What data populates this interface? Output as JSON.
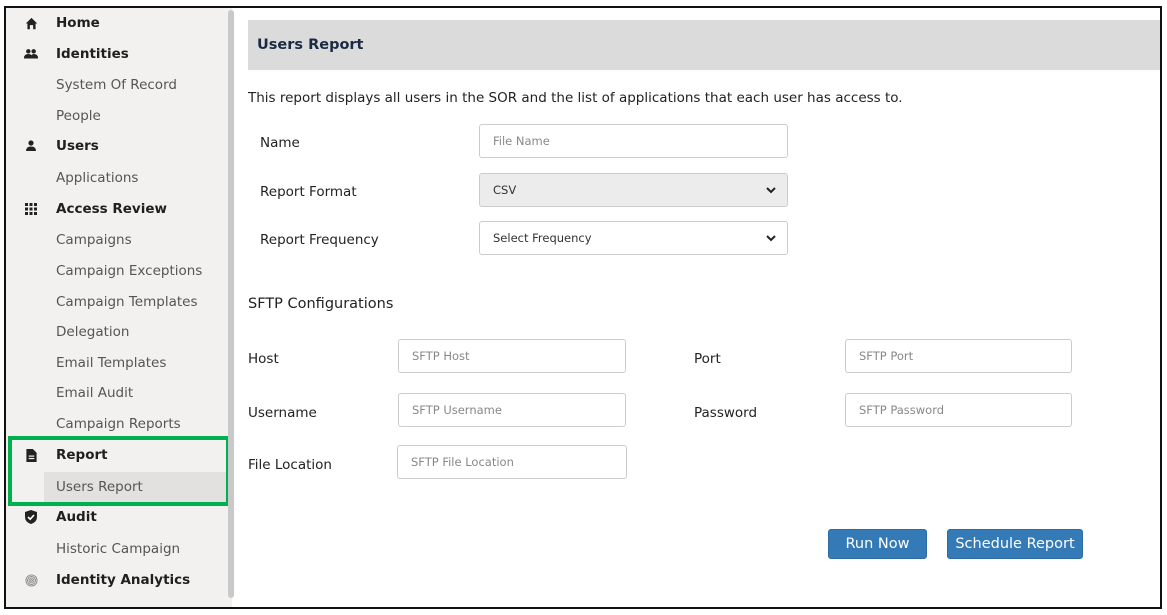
{
  "sidebar": {
    "items": [
      {
        "label": "Home",
        "type": "header",
        "icon": "home-icon"
      },
      {
        "label": "Identities",
        "type": "header",
        "icon": "users-group-icon"
      },
      {
        "label": "System Of Record",
        "type": "child"
      },
      {
        "label": "People",
        "type": "child"
      },
      {
        "label": "Users",
        "type": "header",
        "icon": "user-icon"
      },
      {
        "label": "Applications",
        "type": "child"
      },
      {
        "label": "Access Review",
        "type": "header",
        "icon": "grid-icon"
      },
      {
        "label": "Campaigns",
        "type": "child"
      },
      {
        "label": "Campaign Exceptions",
        "type": "child"
      },
      {
        "label": "Campaign Templates",
        "type": "child"
      },
      {
        "label": "Delegation",
        "type": "child"
      },
      {
        "label": "Email Templates",
        "type": "child"
      },
      {
        "label": "Email Audit",
        "type": "child"
      },
      {
        "label": "Campaign Reports",
        "type": "child"
      },
      {
        "label": "Report",
        "type": "header",
        "icon": "file-icon"
      },
      {
        "label": "Users Report",
        "type": "child",
        "active": true
      },
      {
        "label": "Audit",
        "type": "header",
        "icon": "shield-check-icon"
      },
      {
        "label": "Historic Campaign",
        "type": "child"
      },
      {
        "label": "Identity Analytics",
        "type": "header",
        "icon": "fingerprint-icon"
      }
    ],
    "highlight_color": "#00b050"
  },
  "main": {
    "title": "Users Report",
    "description": "This report displays all users in the SOR and the list of applications that each user has access to.",
    "form": {
      "name_label": "Name",
      "name_placeholder": "File Name",
      "format_label": "Report Format",
      "format_value": "CSV",
      "frequency_label": "Report Frequency",
      "frequency_value": "Select Frequency"
    },
    "sftp": {
      "title": "SFTP Configurations",
      "host_label": "Host",
      "host_placeholder": "SFTP Host",
      "port_label": "Port",
      "port_placeholder": "SFTP Port",
      "username_label": "Username",
      "username_placeholder": "SFTP Username",
      "password_label": "Password",
      "password_placeholder": "SFTP Password",
      "location_label": "File Location",
      "location_placeholder": "SFTP File Location"
    },
    "buttons": {
      "run_now": "Run Now",
      "schedule": "Schedule Report"
    },
    "colors": {
      "button": "#337ab7",
      "title_bar": "#dbdbdb",
      "title_text": "#1b2a44"
    }
  }
}
